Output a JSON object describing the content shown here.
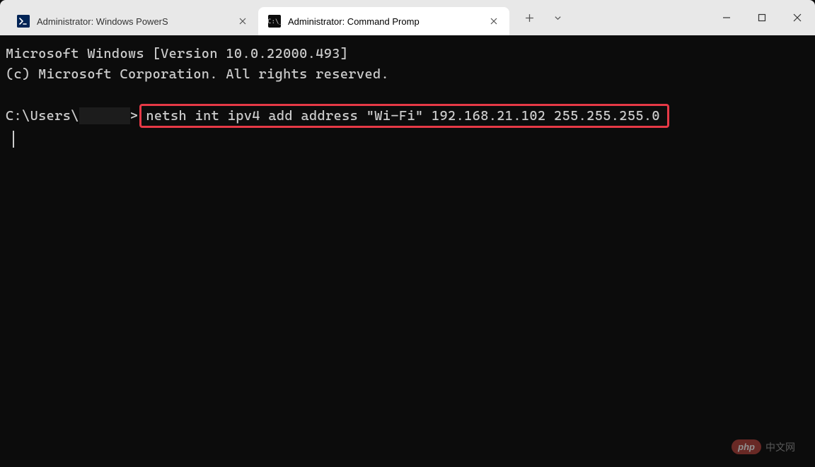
{
  "tabs": [
    {
      "title": "Administrator: Windows PowerS",
      "icon": "powershell"
    },
    {
      "title": "Administrator: Command Promp",
      "icon": "cmd"
    }
  ],
  "terminal": {
    "line1": "Microsoft Windows [Version 10.0.22000.493]",
    "line2": "(c) Microsoft Corporation. All rights reserved.",
    "prompt_prefix": "C:\\Users\\",
    "prompt_suffix": ">",
    "command": "netsh int ipv4 add address \"Wi-Fi\" 192.168.21.102 255.255.255.0"
  },
  "watermark": {
    "badge": "php",
    "text": "中文网"
  }
}
